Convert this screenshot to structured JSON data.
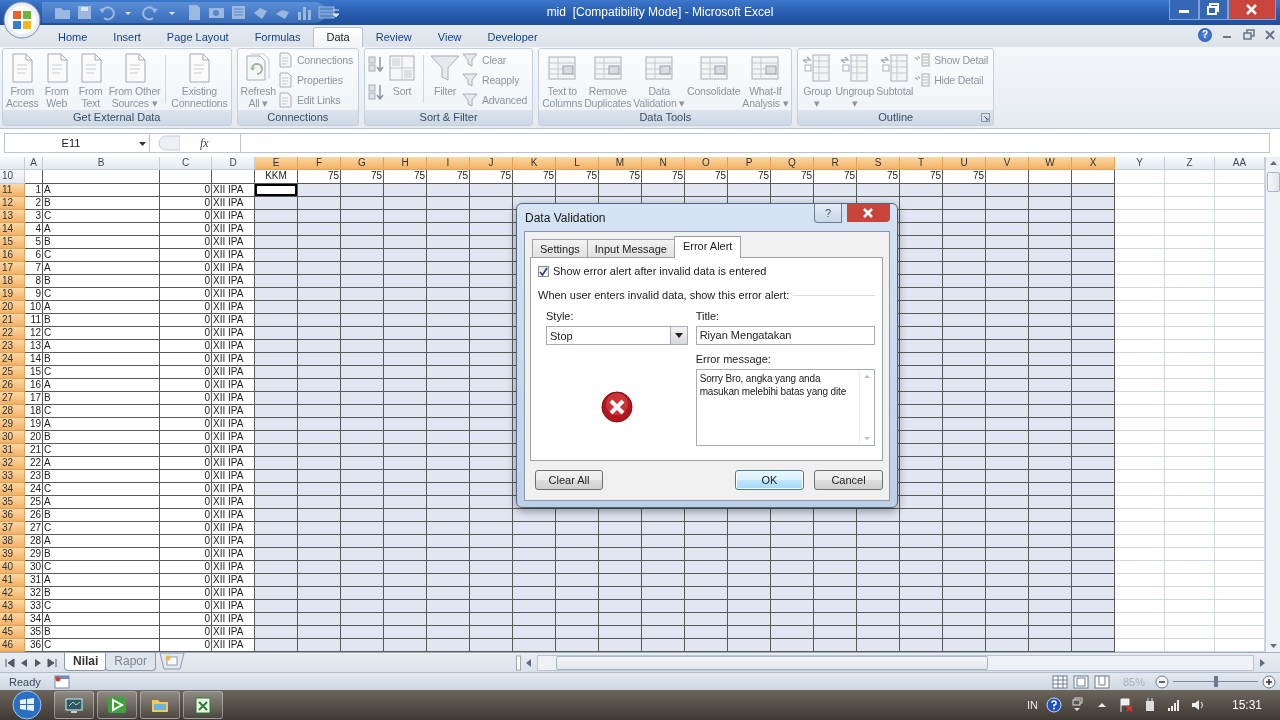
{
  "window": {
    "title": "mid  [Compatibility Mode] - Microsoft Excel"
  },
  "ribbon_tabs": {
    "help_symbol": "?",
    "tabs": [
      {
        "label": "Home",
        "selected": false
      },
      {
        "label": "Insert",
        "selected": false
      },
      {
        "label": "Page Layout",
        "selected": false
      },
      {
        "label": "Formulas",
        "selected": false
      },
      {
        "label": "Data",
        "selected": true
      },
      {
        "label": "Review",
        "selected": false
      },
      {
        "label": "View",
        "selected": false
      },
      {
        "label": "Developer",
        "selected": false
      }
    ]
  },
  "ribbon": {
    "disabled": true,
    "groups": [
      {
        "title": "Get External Data",
        "launcher": false,
        "items": [
          {
            "kind": "large",
            "lines": [
              "From",
              "Access"
            ]
          },
          {
            "kind": "large",
            "lines": [
              "From",
              "Web"
            ]
          },
          {
            "kind": "large",
            "lines": [
              "From",
              "Text"
            ]
          },
          {
            "kind": "large",
            "lines": [
              "From Other",
              "Sources ▾"
            ]
          },
          {
            "kind": "separator"
          },
          {
            "kind": "large",
            "lines": [
              "Existing",
              "Connections"
            ]
          }
        ]
      },
      {
        "title": "Connections",
        "launcher": false,
        "items": [
          {
            "kind": "large",
            "lines": [
              "Refresh",
              "All ▾"
            ]
          },
          {
            "kind": "stack",
            "labels": [
              "Connections",
              "Properties",
              "Edit Links"
            ]
          }
        ]
      },
      {
        "title": "Sort & Filter",
        "launcher": false,
        "items": [
          {
            "kind": "icon-stack"
          },
          {
            "kind": "large",
            "lines": [
              "Sort"
            ]
          },
          {
            "kind": "separator"
          },
          {
            "kind": "large",
            "lines": [
              "Filter"
            ]
          },
          {
            "kind": "stack",
            "labels": [
              "Clear",
              "Reapply",
              "Advanced"
            ]
          }
        ]
      },
      {
        "title": "Data Tools",
        "launcher": false,
        "items": [
          {
            "kind": "large",
            "lines": [
              "Text to",
              "Columns"
            ]
          },
          {
            "kind": "large",
            "lines": [
              "Remove",
              "Duplicates"
            ]
          },
          {
            "kind": "large",
            "lines": [
              "Data",
              "Validation ▾"
            ]
          },
          {
            "kind": "large",
            "lines": [
              "Consolidate"
            ]
          },
          {
            "kind": "large",
            "lines": [
              "What-If",
              "Analysis ▾"
            ]
          }
        ]
      },
      {
        "title": "Outline",
        "launcher": true,
        "items": [
          {
            "kind": "large",
            "lines": [
              "Group",
              "▾"
            ]
          },
          {
            "kind": "large",
            "lines": [
              "Ungroup",
              "▾"
            ]
          },
          {
            "kind": "large",
            "lines": [
              "Subtotal"
            ]
          },
          {
            "kind": "stack",
            "labels": [
              "Show Detail",
              "Hide Detail"
            ]
          }
        ]
      }
    ]
  },
  "formula_bar": {
    "name_box": "E11",
    "function_symbol": "fx"
  },
  "grid": {
    "columns": [
      {
        "label": "A",
        "selected": false
      },
      {
        "label": "B",
        "selected": false
      },
      {
        "label": "C",
        "selected": false
      },
      {
        "label": "D",
        "selected": false
      },
      {
        "label": "E",
        "selected": true
      },
      {
        "label": "F",
        "selected": true
      },
      {
        "label": "G",
        "selected": true
      },
      {
        "label": "H",
        "selected": true
      },
      {
        "label": "I",
        "selected": true
      },
      {
        "label": "J",
        "selected": true
      },
      {
        "label": "K",
        "selected": true
      },
      {
        "label": "L",
        "selected": true
      },
      {
        "label": "M",
        "selected": true
      },
      {
        "label": "N",
        "selected": true
      },
      {
        "label": "O",
        "selected": true
      },
      {
        "label": "P",
        "selected": true
      },
      {
        "label": "Q",
        "selected": true
      },
      {
        "label": "R",
        "selected": true
      },
      {
        "label": "S",
        "selected": true
      },
      {
        "label": "T",
        "selected": true
      },
      {
        "label": "U",
        "selected": true
      },
      {
        "label": "V",
        "selected": true
      },
      {
        "label": "W",
        "selected": true
      },
      {
        "label": "X",
        "selected": true
      },
      {
        "label": "Y",
        "selected": false
      },
      {
        "label": "Z",
        "selected": false
      },
      {
        "label": "AA",
        "selected": false
      }
    ],
    "rows": [
      {
        "kind": "kkm",
        "label": "10",
        "selected": false,
        "kkm_label": "KKM",
        "kkm_values": [
          "75",
          "75",
          "75",
          "75",
          "75",
          "75",
          "75",
          "75",
          "75",
          "75",
          "75",
          "75",
          "75",
          "75",
          "75",
          "75"
        ]
      },
      {
        "kind": "student",
        "label": "11",
        "selected": true,
        "cursor": true,
        "a": "1",
        "b": "A",
        "c": "0",
        "d": "XII IPA"
      },
      {
        "kind": "student",
        "label": "12",
        "selected": true,
        "cursor": false,
        "a": "2",
        "b": "B",
        "c": "0",
        "d": "XII IPA"
      },
      {
        "kind": "student",
        "label": "13",
        "selected": true,
        "cursor": false,
        "a": "3",
        "b": "C",
        "c": "0",
        "d": "XII IPA"
      },
      {
        "kind": "student",
        "label": "14",
        "selected": true,
        "cursor": false,
        "a": "4",
        "b": "A",
        "c": "0",
        "d": "XII IPA"
      },
      {
        "kind": "student",
        "label": "15",
        "selected": true,
        "cursor": false,
        "a": "5",
        "b": "B",
        "c": "0",
        "d": "XII IPA"
      },
      {
        "kind": "student",
        "label": "16",
        "selected": true,
        "cursor": false,
        "a": "6",
        "b": "C",
        "c": "0",
        "d": "XII IPA"
      },
      {
        "kind": "student",
        "label": "17",
        "selected": true,
        "cursor": false,
        "a": "7",
        "b": "A",
        "c": "0",
        "d": "XII IPA"
      },
      {
        "kind": "student",
        "label": "18",
        "selected": true,
        "cursor": false,
        "a": "8",
        "b": "B",
        "c": "0",
        "d": "XII IPA"
      },
      {
        "kind": "student",
        "label": "19",
        "selected": true,
        "cursor": false,
        "a": "9",
        "b": "C",
        "c": "0",
        "d": "XII IPA"
      },
      {
        "kind": "student",
        "label": "20",
        "selected": true,
        "cursor": false,
        "a": "10",
        "b": "A",
        "c": "0",
        "d": "XII IPA"
      },
      {
        "kind": "student",
        "label": "21",
        "selected": true,
        "cursor": false,
        "a": "11",
        "b": "B",
        "c": "0",
        "d": "XII IPA"
      },
      {
        "kind": "student",
        "label": "22",
        "selected": true,
        "cursor": false,
        "a": "12",
        "b": "C",
        "c": "0",
        "d": "XII IPA"
      },
      {
        "kind": "student",
        "label": "23",
        "selected": true,
        "cursor": false,
        "a": "13",
        "b": "A",
        "c": "0",
        "d": "XII IPA"
      },
      {
        "kind": "student",
        "label": "24",
        "selected": true,
        "cursor": false,
        "a": "14",
        "b": "B",
        "c": "0",
        "d": "XII IPA"
      },
      {
        "kind": "student",
        "label": "25",
        "selected": true,
        "cursor": false,
        "a": "15",
        "b": "C",
        "c": "0",
        "d": "XII IPA"
      },
      {
        "kind": "student",
        "label": "26",
        "selected": true,
        "cursor": false,
        "a": "16",
        "b": "A",
        "c": "0",
        "d": "XII IPA"
      },
      {
        "kind": "student",
        "label": "27",
        "selected": true,
        "cursor": false,
        "a": "17",
        "b": "B",
        "c": "0",
        "d": "XII IPA"
      },
      {
        "kind": "student",
        "label": "28",
        "selected": true,
        "cursor": false,
        "a": "18",
        "b": "C",
        "c": "0",
        "d": "XII IPA"
      },
      {
        "kind": "student",
        "label": "29",
        "selected": true,
        "cursor": false,
        "a": "19",
        "b": "A",
        "c": "0",
        "d": "XII IPA"
      },
      {
        "kind": "student",
        "label": "30",
        "selected": true,
        "cursor": false,
        "a": "20",
        "b": "B",
        "c": "0",
        "d": "XII IPA"
      },
      {
        "kind": "student",
        "label": "31",
        "selected": true,
        "cursor": false,
        "a": "21",
        "b": "C",
        "c": "0",
        "d": "XII IPA"
      },
      {
        "kind": "student",
        "label": "32",
        "selected": true,
        "cursor": false,
        "a": "22",
        "b": "A",
        "c": "0",
        "d": "XII IPA"
      },
      {
        "kind": "student",
        "label": "33",
        "selected": true,
        "cursor": false,
        "a": "23",
        "b": "B",
        "c": "0",
        "d": "XII IPA"
      },
      {
        "kind": "student",
        "label": "34",
        "selected": true,
        "cursor": false,
        "a": "24",
        "b": "C",
        "c": "0",
        "d": "XII IPA"
      },
      {
        "kind": "student",
        "label": "35",
        "selected": true,
        "cursor": false,
        "a": "25",
        "b": "A",
        "c": "0",
        "d": "XII IPA"
      },
      {
        "kind": "student",
        "label": "36",
        "selected": true,
        "cursor": false,
        "a": "26",
        "b": "B",
        "c": "0",
        "d": "XII IPA"
      },
      {
        "kind": "student",
        "label": "37",
        "selected": true,
        "cursor": false,
        "a": "27",
        "b": "C",
        "c": "0",
        "d": "XII IPA"
      },
      {
        "kind": "student",
        "label": "38",
        "selected": true,
        "cursor": false,
        "a": "28",
        "b": "A",
        "c": "0",
        "d": "XII IPA"
      },
      {
        "kind": "student",
        "label": "39",
        "selected": true,
        "cursor": false,
        "a": "29",
        "b": "B",
        "c": "0",
        "d": "XII IPA"
      },
      {
        "kind": "student",
        "label": "40",
        "selected": true,
        "cursor": false,
        "a": "30",
        "b": "C",
        "c": "0",
        "d": "XII IPA"
      },
      {
        "kind": "student",
        "label": "41",
        "selected": true,
        "cursor": false,
        "a": "31",
        "b": "A",
        "c": "0",
        "d": "XII IPA"
      },
      {
        "kind": "student",
        "label": "42",
        "selected": true,
        "cursor": false,
        "a": "32",
        "b": "B",
        "c": "0",
        "d": "XII IPA"
      },
      {
        "kind": "student",
        "label": "43",
        "selected": true,
        "cursor": false,
        "a": "33",
        "b": "C",
        "c": "0",
        "d": "XII IPA"
      },
      {
        "kind": "student",
        "label": "44",
        "selected": true,
        "cursor": false,
        "a": "34",
        "b": "A",
        "c": "0",
        "d": "XII IPA"
      },
      {
        "kind": "student",
        "label": "45",
        "selected": true,
        "cursor": false,
        "a": "35",
        "b": "B",
        "c": "0",
        "d": "XII IPA"
      },
      {
        "kind": "student",
        "label": "46",
        "selected": true,
        "cursor": false,
        "a": "36",
        "b": "C",
        "c": "0",
        "d": "XII IPA"
      }
    ]
  },
  "dialog": {
    "title": "Data Validation",
    "help_symbol": "?",
    "tabs": [
      {
        "label": "Settings",
        "selected": false
      },
      {
        "label": "Input Message",
        "selected": false
      },
      {
        "label": "Error Alert",
        "selected": true
      }
    ],
    "show_alert": {
      "label": "Show error alert after invalid data is entered",
      "checked": true
    },
    "section_label": "When user enters invalid data, show this error alert:",
    "style": {
      "label": "Style:",
      "value": "Stop"
    },
    "title_field": {
      "label": "Title:",
      "value": "Riyan Mengatakan"
    },
    "message": {
      "label": "Error message:",
      "value": "Sorry Bro, angka yang anda masukan melebihi batas yang dite"
    },
    "buttons": [
      {
        "label": "Clear All",
        "default": false
      },
      {
        "label": "OK",
        "default": true
      },
      {
        "label": "Cancel",
        "default": false
      }
    ]
  },
  "sheet_tabs": [
    {
      "label": "Nilai",
      "selected": true
    },
    {
      "label": "Rapor",
      "selected": false
    }
  ],
  "status_bar": {
    "text": "Ready",
    "zoom": "85%",
    "zoom_slider": {
      "level": 0.5
    }
  },
  "taskbar": {
    "language": "IN",
    "clock": "15:31"
  }
}
